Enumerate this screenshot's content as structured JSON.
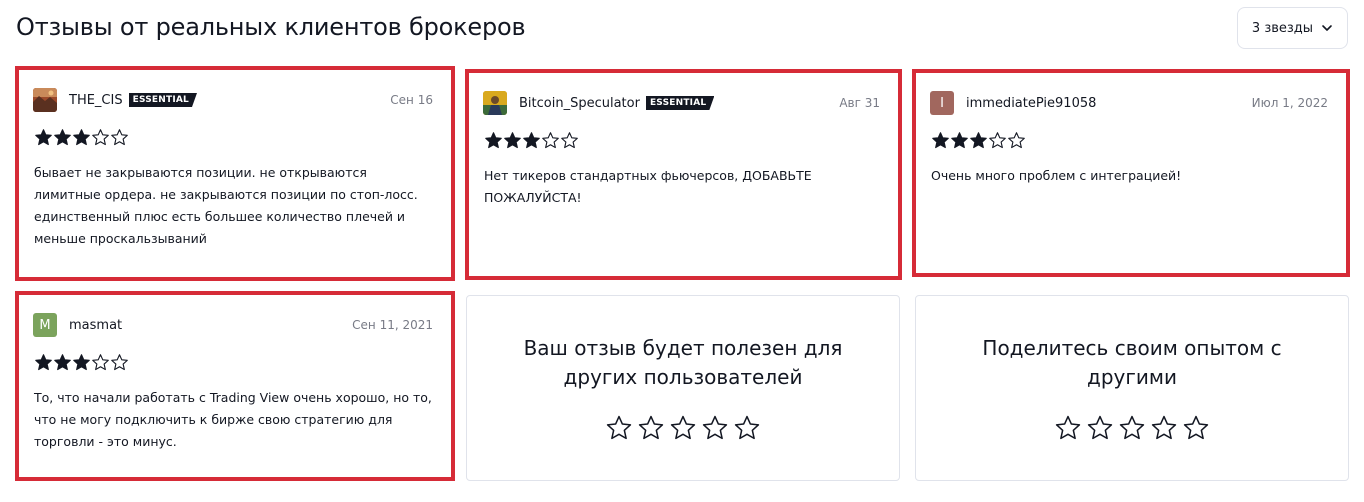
{
  "header": {
    "title": "Отзывы от реальных клиентов брокеров",
    "filter_label": "3 звезды"
  },
  "colors": {
    "highlight": "#d62b37",
    "star": "#131722",
    "badge_bg": "#131722"
  },
  "reviews": [
    {
      "author": "THE_CIS",
      "badge": "ESSENTIAL",
      "date": "Сен 16",
      "rating": 3,
      "avatar": {
        "type": "image",
        "icon": "landscape-avatar-icon",
        "color": "#b5653a"
      },
      "text": "бывает не закрываются позиции. не открываются лимитные ордера. не закрываются позиции по стоп-лосс. единственный плюс есть большее количество плечей и меньше проскальзываний"
    },
    {
      "author": "Bitcoin_Speculator",
      "badge": "ESSENTIAL",
      "date": "Авг 31",
      "rating": 3,
      "avatar": {
        "type": "image",
        "icon": "trader-avatar-icon",
        "color": "#d9a91e"
      },
      "text": "Нет тикеров стандартных фьючерсов, ДОБАВЬТЕ ПОЖАЛУЙСТА!"
    },
    {
      "author": "immediatePie91058",
      "badge": "",
      "date": "Июл 1, 2022",
      "rating": 3,
      "avatar": {
        "type": "letter",
        "letter": "I",
        "color": "#a1675e"
      },
      "text": "Очень много проблем с интеграцией!"
    },
    {
      "author": "masmat",
      "badge": "",
      "date": "Сен 11, 2021",
      "rating": 3,
      "avatar": {
        "type": "letter",
        "letter": "M",
        "color": "#7ba35c"
      },
      "text": "То, что начали работать с Trading View очень хорошо, но то, что не могу подключить к бирже свою стратегию для торговли - это минус."
    }
  ],
  "cta_cards": [
    {
      "title": "Ваш отзыв будет полезен для других пользователей"
    },
    {
      "title": "Поделитесь своим опытом с другими"
    }
  ]
}
